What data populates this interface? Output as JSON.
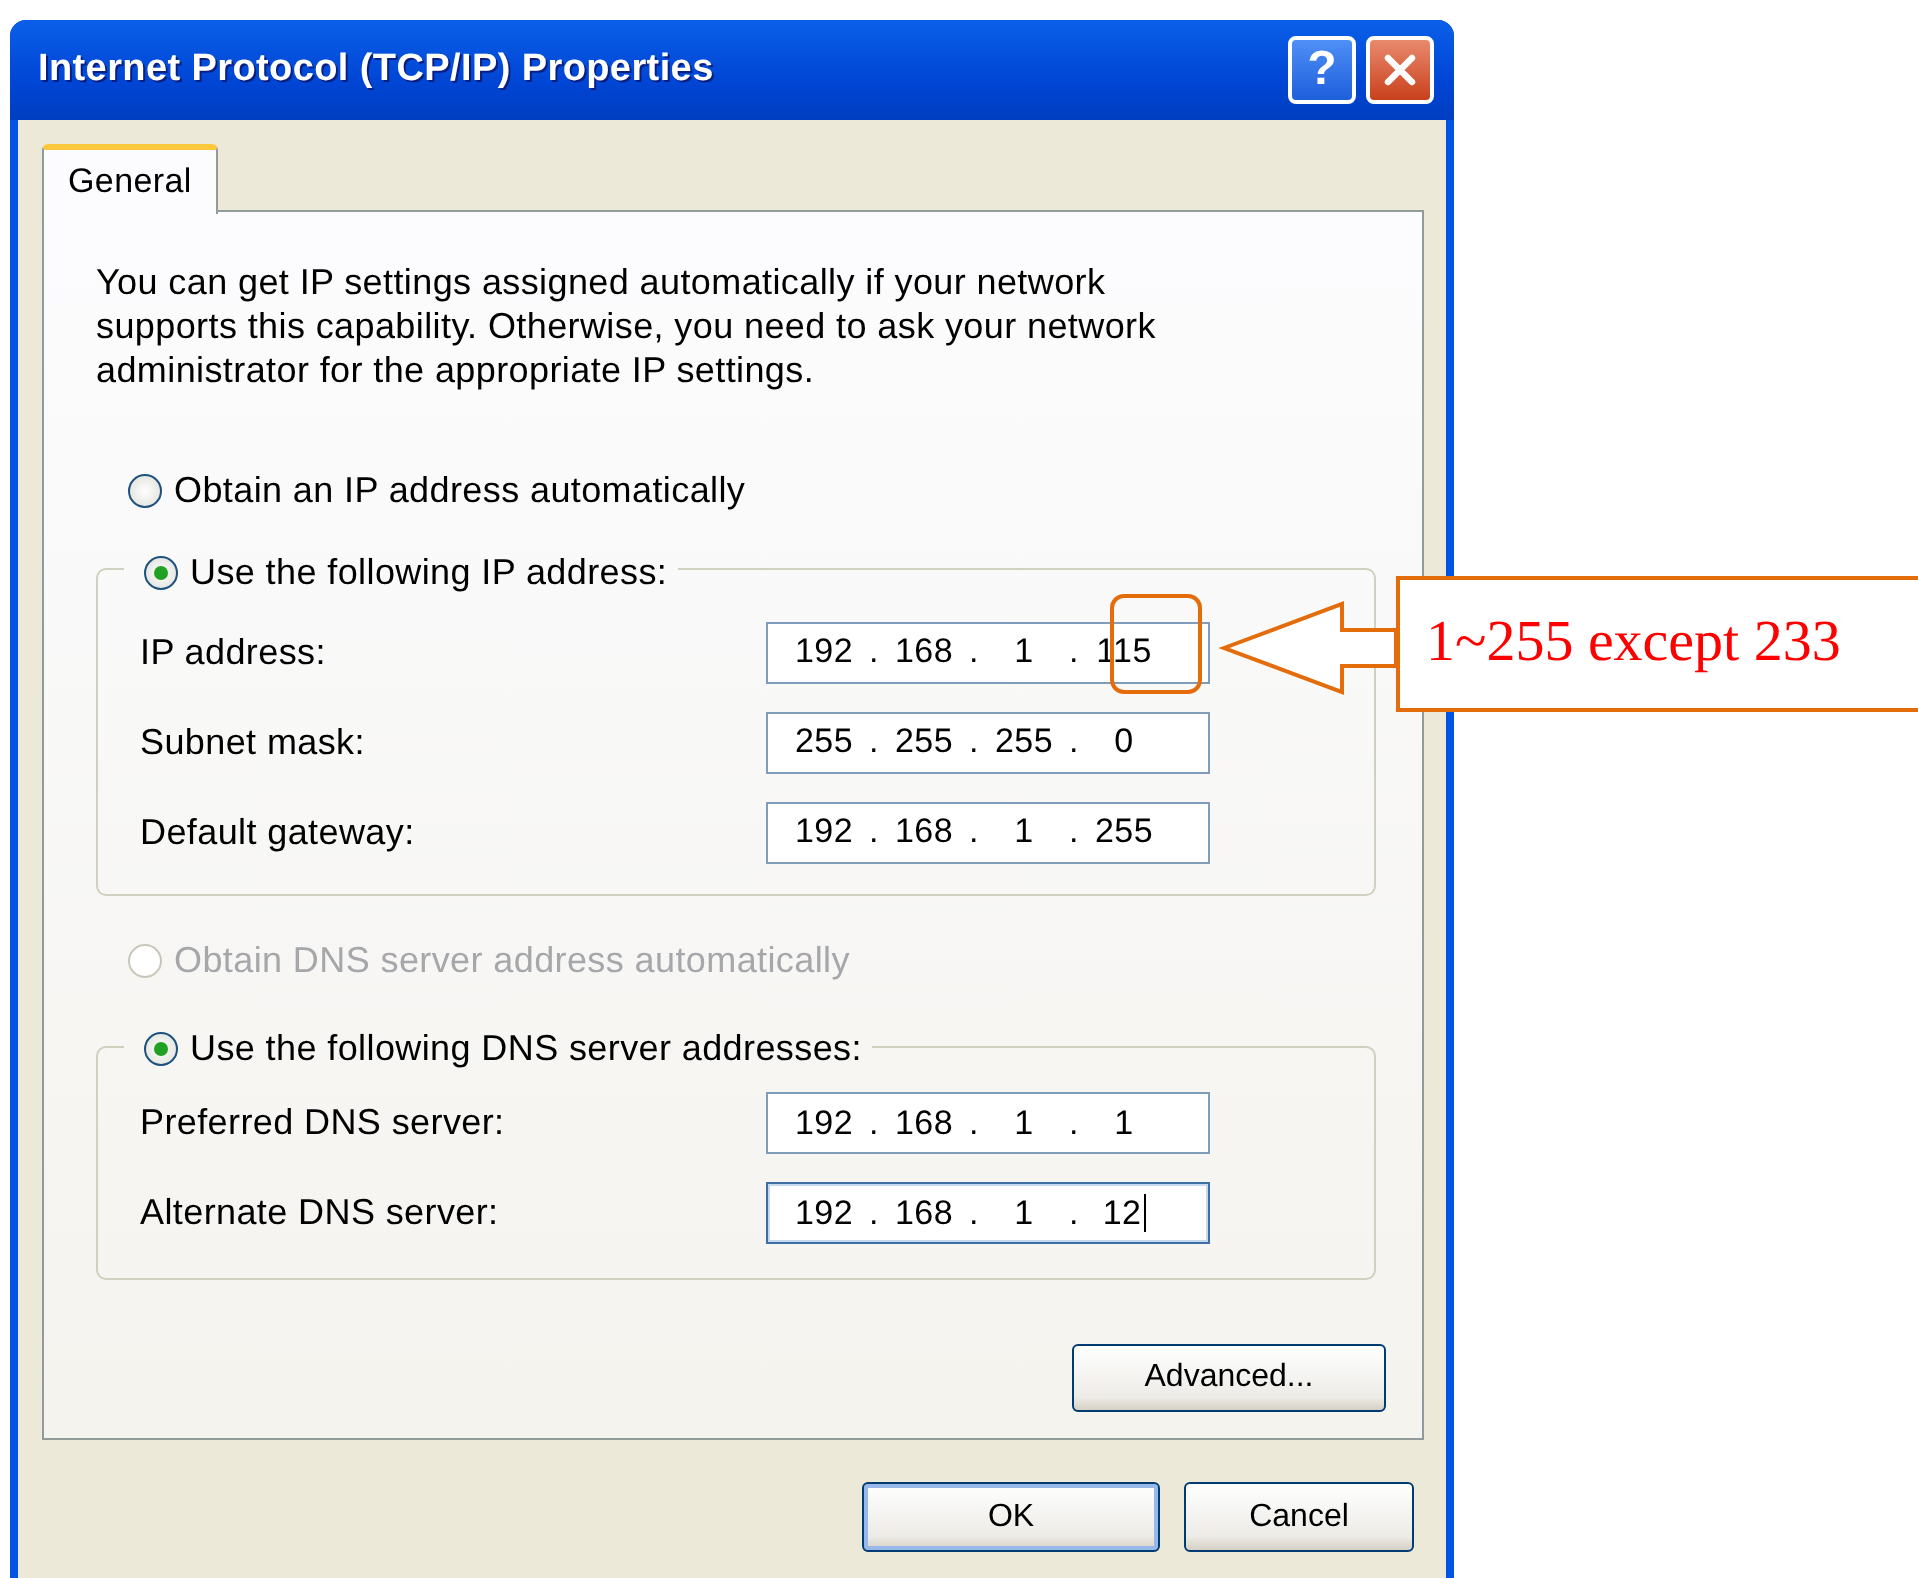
{
  "window": {
    "title": "Internet Protocol (TCP/IP) Properties",
    "help_glyph": "?"
  },
  "tabs": [
    {
      "label": "General",
      "selected": true
    }
  ],
  "description": "You can get IP settings assigned automatically if your network supports this capability. Otherwise, you need to ask your network administrator for the appropriate IP settings.",
  "ip_mode": [
    {
      "label": "Obtain an IP address automatically",
      "selected": false,
      "disabled": false
    },
    {
      "label": "Use the following IP address:",
      "selected": true,
      "disabled": false
    }
  ],
  "ip_fields": [
    {
      "label": "IP address:",
      "octets": [
        "192",
        "168",
        "1",
        "115"
      ],
      "focused": false
    },
    {
      "label": "Subnet mask:",
      "octets": [
        "255",
        "255",
        "255",
        "0"
      ],
      "focused": false
    },
    {
      "label": "Default gateway:",
      "octets": [
        "192",
        "168",
        "1",
        "255"
      ],
      "focused": false
    }
  ],
  "dns_mode": [
    {
      "label": "Obtain DNS server address automatically",
      "selected": false,
      "disabled": true
    },
    {
      "label": "Use the following DNS server addresses:",
      "selected": true,
      "disabled": false
    }
  ],
  "dns_fields": [
    {
      "label": "Preferred DNS server:",
      "octets": [
        "192",
        "168",
        "1",
        "1"
      ],
      "focused": false
    },
    {
      "label": "Alternate DNS server:",
      "octets": [
        "192",
        "168",
        "1",
        "12"
      ],
      "focused": true
    }
  ],
  "octet_separator": ".",
  "advanced_button": "Advanced...",
  "buttons": [
    {
      "label": "OK",
      "default": true
    },
    {
      "label": "Cancel",
      "default": false
    }
  ],
  "annotation": {
    "text": "1~255 except 233"
  }
}
